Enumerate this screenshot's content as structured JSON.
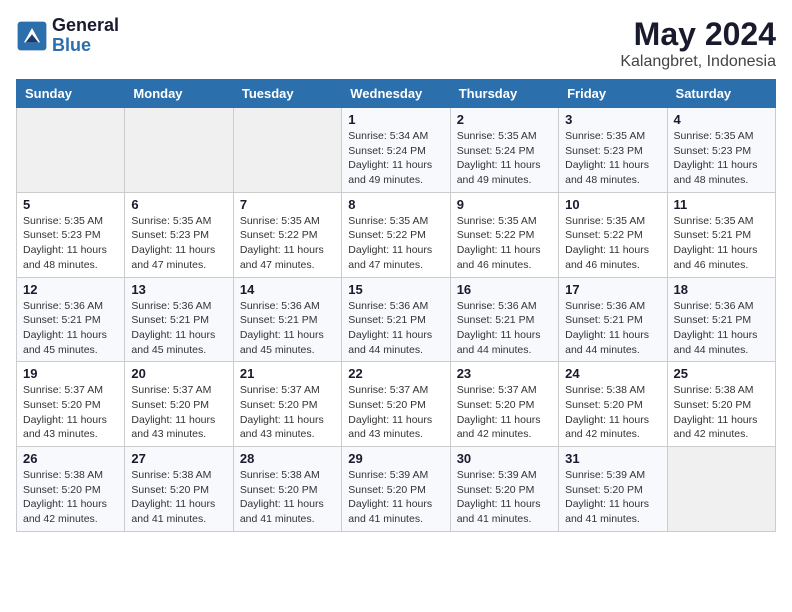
{
  "header": {
    "logo_text_general": "General",
    "logo_text_blue": "Blue",
    "month": "May 2024",
    "location": "Kalangbret, Indonesia"
  },
  "days_of_week": [
    "Sunday",
    "Monday",
    "Tuesday",
    "Wednesday",
    "Thursday",
    "Friday",
    "Saturday"
  ],
  "weeks": [
    [
      {
        "day": "",
        "info": ""
      },
      {
        "day": "",
        "info": ""
      },
      {
        "day": "",
        "info": ""
      },
      {
        "day": "1",
        "info": "Sunrise: 5:34 AM\nSunset: 5:24 PM\nDaylight: 11 hours and 49 minutes."
      },
      {
        "day": "2",
        "info": "Sunrise: 5:35 AM\nSunset: 5:24 PM\nDaylight: 11 hours and 49 minutes."
      },
      {
        "day": "3",
        "info": "Sunrise: 5:35 AM\nSunset: 5:23 PM\nDaylight: 11 hours and 48 minutes."
      },
      {
        "day": "4",
        "info": "Sunrise: 5:35 AM\nSunset: 5:23 PM\nDaylight: 11 hours and 48 minutes."
      }
    ],
    [
      {
        "day": "5",
        "info": "Sunrise: 5:35 AM\nSunset: 5:23 PM\nDaylight: 11 hours and 48 minutes."
      },
      {
        "day": "6",
        "info": "Sunrise: 5:35 AM\nSunset: 5:23 PM\nDaylight: 11 hours and 47 minutes."
      },
      {
        "day": "7",
        "info": "Sunrise: 5:35 AM\nSunset: 5:22 PM\nDaylight: 11 hours and 47 minutes."
      },
      {
        "day": "8",
        "info": "Sunrise: 5:35 AM\nSunset: 5:22 PM\nDaylight: 11 hours and 47 minutes."
      },
      {
        "day": "9",
        "info": "Sunrise: 5:35 AM\nSunset: 5:22 PM\nDaylight: 11 hours and 46 minutes."
      },
      {
        "day": "10",
        "info": "Sunrise: 5:35 AM\nSunset: 5:22 PM\nDaylight: 11 hours and 46 minutes."
      },
      {
        "day": "11",
        "info": "Sunrise: 5:35 AM\nSunset: 5:21 PM\nDaylight: 11 hours and 46 minutes."
      }
    ],
    [
      {
        "day": "12",
        "info": "Sunrise: 5:36 AM\nSunset: 5:21 PM\nDaylight: 11 hours and 45 minutes."
      },
      {
        "day": "13",
        "info": "Sunrise: 5:36 AM\nSunset: 5:21 PM\nDaylight: 11 hours and 45 minutes."
      },
      {
        "day": "14",
        "info": "Sunrise: 5:36 AM\nSunset: 5:21 PM\nDaylight: 11 hours and 45 minutes."
      },
      {
        "day": "15",
        "info": "Sunrise: 5:36 AM\nSunset: 5:21 PM\nDaylight: 11 hours and 44 minutes."
      },
      {
        "day": "16",
        "info": "Sunrise: 5:36 AM\nSunset: 5:21 PM\nDaylight: 11 hours and 44 minutes."
      },
      {
        "day": "17",
        "info": "Sunrise: 5:36 AM\nSunset: 5:21 PM\nDaylight: 11 hours and 44 minutes."
      },
      {
        "day": "18",
        "info": "Sunrise: 5:36 AM\nSunset: 5:21 PM\nDaylight: 11 hours and 44 minutes."
      }
    ],
    [
      {
        "day": "19",
        "info": "Sunrise: 5:37 AM\nSunset: 5:20 PM\nDaylight: 11 hours and 43 minutes."
      },
      {
        "day": "20",
        "info": "Sunrise: 5:37 AM\nSunset: 5:20 PM\nDaylight: 11 hours and 43 minutes."
      },
      {
        "day": "21",
        "info": "Sunrise: 5:37 AM\nSunset: 5:20 PM\nDaylight: 11 hours and 43 minutes."
      },
      {
        "day": "22",
        "info": "Sunrise: 5:37 AM\nSunset: 5:20 PM\nDaylight: 11 hours and 43 minutes."
      },
      {
        "day": "23",
        "info": "Sunrise: 5:37 AM\nSunset: 5:20 PM\nDaylight: 11 hours and 42 minutes."
      },
      {
        "day": "24",
        "info": "Sunrise: 5:38 AM\nSunset: 5:20 PM\nDaylight: 11 hours and 42 minutes."
      },
      {
        "day": "25",
        "info": "Sunrise: 5:38 AM\nSunset: 5:20 PM\nDaylight: 11 hours and 42 minutes."
      }
    ],
    [
      {
        "day": "26",
        "info": "Sunrise: 5:38 AM\nSunset: 5:20 PM\nDaylight: 11 hours and 42 minutes."
      },
      {
        "day": "27",
        "info": "Sunrise: 5:38 AM\nSunset: 5:20 PM\nDaylight: 11 hours and 41 minutes."
      },
      {
        "day": "28",
        "info": "Sunrise: 5:38 AM\nSunset: 5:20 PM\nDaylight: 11 hours and 41 minutes."
      },
      {
        "day": "29",
        "info": "Sunrise: 5:39 AM\nSunset: 5:20 PM\nDaylight: 11 hours and 41 minutes."
      },
      {
        "day": "30",
        "info": "Sunrise: 5:39 AM\nSunset: 5:20 PM\nDaylight: 11 hours and 41 minutes."
      },
      {
        "day": "31",
        "info": "Sunrise: 5:39 AM\nSunset: 5:20 PM\nDaylight: 11 hours and 41 minutes."
      },
      {
        "day": "",
        "info": ""
      }
    ]
  ]
}
